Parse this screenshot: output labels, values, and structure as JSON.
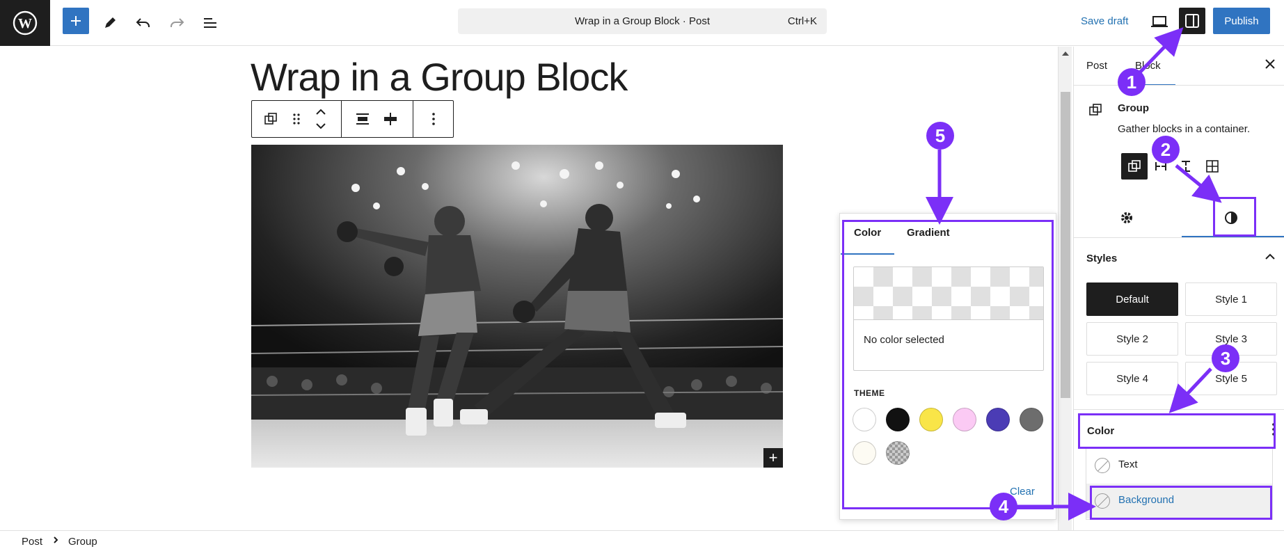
{
  "toolbar": {
    "wp_logo": "wordpress-logo",
    "add_icon": "plus-icon",
    "tools_icon": "pencil-icon",
    "undo_icon": "undo-icon",
    "redo_icon": "redo-icon",
    "list_view_icon": "list-view-icon",
    "command_title": "Wrap in a Group Block · Post",
    "command_shortcut": "Ctrl+K",
    "save_draft": "Save draft",
    "preview_icon": "laptop-icon",
    "settings_icon": "sidebar-toggle-icon",
    "publish": "Publish"
  },
  "editor": {
    "post_title": "Wrap in a Group Block",
    "block_toolbar": [
      "group-icon",
      "drag-handle-icon",
      "move-up-down-icon",
      "align-icon",
      "justify-icon",
      "more-options-icon"
    ],
    "image_alt": "Black and white boxing photograph"
  },
  "popover": {
    "tabs": [
      "Color",
      "Gradient"
    ],
    "active_tab": "Color",
    "no_color_text": "No color selected",
    "theme_label": "THEME",
    "swatches": [
      "#ffffff",
      "#111111",
      "#f9e548",
      "#fbcaf4",
      "#4b3cb5",
      "#6d6d6d",
      "#fdfbf3",
      "checker"
    ],
    "clear": "Clear"
  },
  "sidebar": {
    "tabs": [
      "Post",
      "Block"
    ],
    "active_tab": "Block",
    "close_icon": "close-icon",
    "block_name": "Group",
    "block_description": "Gather blocks in a container.",
    "variations": [
      "group-icon",
      "row-icon",
      "stack-icon",
      "grid-icon"
    ],
    "sub_tabs": [
      "settings-icon",
      "styles-icon"
    ],
    "styles_title": "Styles",
    "styles": [
      "Default",
      "Style 1",
      "Style 2",
      "Style 3",
      "Style 4",
      "Style 5"
    ],
    "color_title": "Color",
    "color_items": [
      "Text",
      "Background"
    ]
  },
  "breadcrumb": {
    "items": [
      "Post",
      "Group"
    ]
  },
  "annotations": {
    "labels": [
      "1",
      "2",
      "3",
      "4",
      "5"
    ],
    "color": "#7b2ff7"
  }
}
